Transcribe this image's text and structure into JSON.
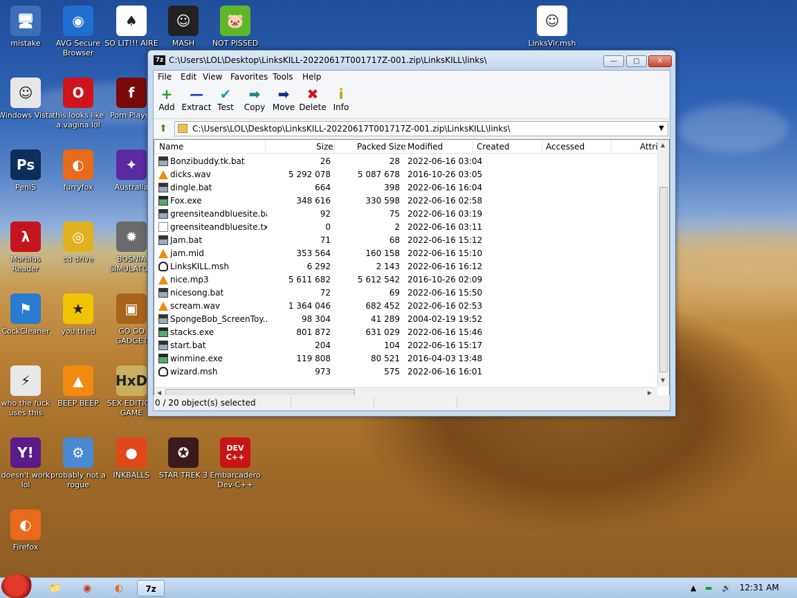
{
  "desktop": {
    "icons": [
      {
        "label": "mistake",
        "glyph": "🖥",
        "color": "#3b6fb6"
      },
      {
        "label": "AVG Secure Browser",
        "glyph": "◉",
        "color": "#1f6fd0"
      },
      {
        "label": "SO LIT!!! AIRE",
        "glyph": "♠",
        "color": "#ffffff"
      },
      {
        "label": "MASH",
        "glyph": "☺",
        "color": "#222222"
      },
      {
        "label": "NOT PISSED",
        "glyph": "🐷",
        "color": "#5cb82a"
      },
      {
        "label": "LinksVir.msh",
        "glyph": "☺",
        "color": "#ffffff"
      },
      {
        "label": "Windows Vista",
        "glyph": "☺",
        "color": "#e8e8e8"
      },
      {
        "label": "this looks like a vagina lol",
        "glyph": "O",
        "color": "#d0141c"
      },
      {
        "label": "Porn Player",
        "glyph": "f",
        "color": "#7a0a0a"
      },
      {
        "label": "PeniS",
        "glyph": "Ps",
        "color": "#0b2f5a"
      },
      {
        "label": "furryfox",
        "glyph": "◐",
        "color": "#e86a1a"
      },
      {
        "label": "Australia",
        "glyph": "✦",
        "color": "#5a2aa0"
      },
      {
        "label": "Morbius Reader",
        "glyph": "λ",
        "color": "#c4141c"
      },
      {
        "label": "cd drive",
        "glyph": "◎",
        "color": "#e0b020"
      },
      {
        "label": "BOSNIA SIMULATOR",
        "glyph": "✹",
        "color": "#6a6a6a"
      },
      {
        "label": "CockCleaner",
        "glyph": "⚑",
        "color": "#2a7ad0"
      },
      {
        "label": "you tried",
        "glyph": "★",
        "color": "#f0c400"
      },
      {
        "label": "GO GO GADGET",
        "glyph": "▣",
        "color": "#a8641a"
      },
      {
        "label": "who the fuck uses this",
        "glyph": "⚡",
        "color": "#e8e8e8"
      },
      {
        "label": "BEEP BEEP",
        "glyph": "▲",
        "color": "#f08a10"
      },
      {
        "label": "SEX EDITION GAME",
        "glyph": "HxD",
        "color": "#c8b060"
      },
      {
        "label": "doesn't work lol",
        "glyph": "Y!",
        "color": "#5a1a8a"
      },
      {
        "label": "probably not a rogue",
        "glyph": "⚙",
        "color": "#4a8ad0"
      },
      {
        "label": "INKBALLS",
        "glyph": "●",
        "color": "#e04a1a"
      },
      {
        "label": "STAR TREK 3",
        "glyph": "✪",
        "color": "#3a1a1a"
      },
      {
        "label": "Embarcadero Dev-C++",
        "glyph": "DEV C++",
        "color": "#c81414"
      },
      {
        "label": "Firefox",
        "glyph": "◐",
        "color": "#e86a1a"
      }
    ]
  },
  "window": {
    "title": "C:\\Users\\LOL\\Desktop\\LinksKILL-20220617T001717Z-001.zip\\LinksKILL\\links\\",
    "app_badge": "7z",
    "minimize": "—",
    "maximize": "▢",
    "close": "✕"
  },
  "menu": [
    "File",
    "Edit",
    "View",
    "Favorites",
    "Tools",
    "Help"
  ],
  "toolbar": [
    {
      "label": "Add",
      "icon": "+",
      "color": "#1ea020"
    },
    {
      "label": "Extract",
      "icon": "—",
      "color": "#1a3ac8"
    },
    {
      "label": "Test",
      "icon": "✔",
      "color": "#1aa0b0"
    },
    {
      "label": "Copy",
      "icon": "➡",
      "color": "#1a8a8a"
    },
    {
      "label": "Move",
      "icon": "➡",
      "color": "#1a2a8a"
    },
    {
      "label": "Delete",
      "icon": "✖",
      "color": "#d01414"
    },
    {
      "label": "Info",
      "icon": "i",
      "color": "#c8a010"
    }
  ],
  "address": {
    "path": "C:\\Users\\LOL\\Desktop\\LinksKILL-20220617T001717Z-001.zip\\LinksKILL\\links\\",
    "dropdown": "▼",
    "up": "⬆"
  },
  "columns": [
    "Name",
    "Size",
    "Packed Size",
    "Modified",
    "Created",
    "Accessed",
    "Attrib"
  ],
  "files": [
    {
      "name": "Bonzibuddy.tk.bat",
      "type": "bat",
      "size": "26",
      "packed": "28",
      "modified": "2022-06-16 03:04"
    },
    {
      "name": "dicks.wav",
      "type": "wav",
      "size": "5 292 078",
      "packed": "5 087 678",
      "modified": "2016-10-26 03:05"
    },
    {
      "name": "dingle.bat",
      "type": "bat",
      "size": "664",
      "packed": "398",
      "modified": "2022-06-16 16:04"
    },
    {
      "name": "Fox.exe",
      "type": "exe",
      "size": "348 616",
      "packed": "330 598",
      "modified": "2022-06-16 02:58"
    },
    {
      "name": "greensiteandbluesite.bat",
      "type": "bat",
      "size": "92",
      "packed": "75",
      "modified": "2022-06-16 03:19"
    },
    {
      "name": "greensiteandbluesite.txt",
      "type": "txt",
      "size": "0",
      "packed": "2",
      "modified": "2022-06-16 03:11"
    },
    {
      "name": "Jam.bat",
      "type": "bat",
      "size": "71",
      "packed": "68",
      "modified": "2022-06-16 15:12"
    },
    {
      "name": "jam.mid",
      "type": "wav",
      "size": "353 564",
      "packed": "160 158",
      "modified": "2022-06-16 15:10"
    },
    {
      "name": "LinksKILL.msh",
      "type": "msh",
      "size": "6 292",
      "packed": "2 143",
      "modified": "2022-06-16 16:12"
    },
    {
      "name": "nice.mp3",
      "type": "wav",
      "size": "5 611 682",
      "packed": "5 612 542",
      "modified": "2016-10-26 02:09"
    },
    {
      "name": "nicesong.bat",
      "type": "bat",
      "size": "72",
      "packed": "69",
      "modified": "2022-06-16 15:50"
    },
    {
      "name": "scream.wav",
      "type": "wav",
      "size": "1 364 046",
      "packed": "682 452",
      "modified": "2022-06-16 02:53"
    },
    {
      "name": "SpongeBob_ScreenToy....",
      "type": "bat",
      "size": "98 304",
      "packed": "41 289",
      "modified": "2004-02-19 19:52"
    },
    {
      "name": "stacks.exe",
      "type": "exe",
      "size": "801 872",
      "packed": "631 029",
      "modified": "2022-06-16 15:46"
    },
    {
      "name": "start.bat",
      "type": "bat",
      "size": "204",
      "packed": "104",
      "modified": "2022-06-16 15:17"
    },
    {
      "name": "winmine.exe",
      "type": "exe",
      "size": "119 808",
      "packed": "80 521",
      "modified": "2016-04-03 13:48"
    },
    {
      "name": "wizard.msh",
      "type": "msh",
      "size": "973",
      "packed": "575",
      "modified": "2022-06-16 16:01"
    }
  ],
  "status": "0 / 20 object(s) selected",
  "taskbar": {
    "clock": "12:31 AM",
    "pinned": [
      {
        "name": "explorer",
        "glyph": "📁"
      },
      {
        "name": "chrome",
        "glyph": "◉"
      },
      {
        "name": "firefox",
        "glyph": "◐"
      },
      {
        "name": "7zip",
        "glyph": "7z"
      }
    ],
    "tray": [
      "▲",
      "▬",
      "🔊"
    ]
  }
}
